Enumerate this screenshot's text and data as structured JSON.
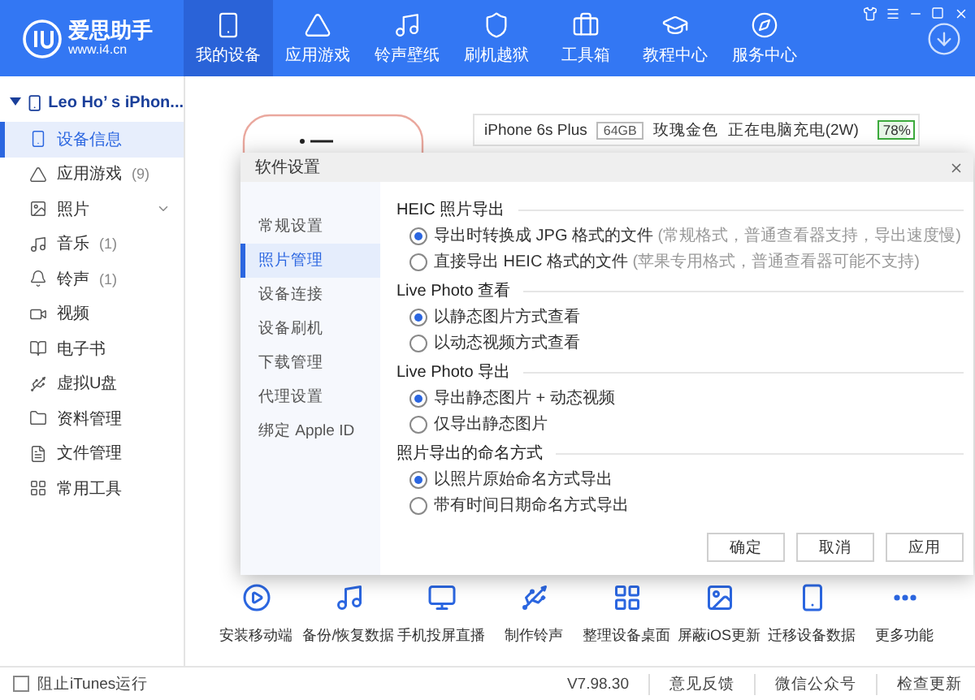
{
  "header": {
    "app_name": "爱思助手",
    "site": "www.i4.cn",
    "nav": [
      {
        "label": "我的设备",
        "selected": true
      },
      {
        "label": "应用游戏",
        "selected": false
      },
      {
        "label": "铃声壁纸",
        "selected": false
      },
      {
        "label": "刷机越狱",
        "selected": false
      },
      {
        "label": "工具箱",
        "selected": false
      },
      {
        "label": "教程中心",
        "selected": false
      },
      {
        "label": "服务中心",
        "selected": false
      }
    ]
  },
  "sidebar": {
    "device": "Leo Ho’ s iPhon...",
    "expanded": true,
    "items": [
      {
        "label": "设备信息",
        "selected": true
      },
      {
        "label": "应用游戏",
        "count": "(9)",
        "selected": false
      },
      {
        "label": "照片",
        "selected": false,
        "expandable": true
      },
      {
        "label": "音乐",
        "count": "(1)",
        "selected": false
      },
      {
        "label": "铃声",
        "count": "(1)",
        "selected": false
      },
      {
        "label": "视频",
        "selected": false
      },
      {
        "label": "电子书",
        "selected": false
      },
      {
        "label": "虚拟U盘",
        "selected": false
      },
      {
        "label": "资料管理",
        "selected": false
      },
      {
        "label": "文件管理",
        "selected": false
      },
      {
        "label": "常用工具",
        "selected": false
      }
    ]
  },
  "device_info": {
    "model": "iPhone 6s Plus",
    "capacity": "64GB",
    "finish": "玫瑰金色",
    "charging": "正在电脑充电(2W)",
    "battery": "78%",
    "level": 0.78
  },
  "toolbar": [
    "安装移动端",
    "备份/恢复数据",
    "手机投屏直播",
    "制作铃声",
    "整理设备桌面",
    "屏蔽iOS更新",
    "迁移设备数据",
    "更多功能"
  ],
  "dialog": {
    "title": "软件设置",
    "nav": [
      {
        "label": "常规设置",
        "selected": false
      },
      {
        "label": "照片管理",
        "selected": true
      },
      {
        "label": "设备连接",
        "selected": false
      },
      {
        "label": "设备刷机",
        "selected": false
      },
      {
        "label": "下载管理",
        "selected": false
      },
      {
        "label": "代理设置",
        "selected": false
      },
      {
        "label": "绑定 Apple ID",
        "selected": false
      }
    ],
    "sections": [
      {
        "title": "HEIC 照片导出",
        "options": [
          {
            "label": "导出时转换成 JPG 格式的文件",
            "hint": "(常规格式，普通查看器支持，导出速度慢)",
            "selected": true
          },
          {
            "label": "直接导出 HEIC 格式的文件",
            "hint": "(苹果专用格式，普通查看器可能不支持)",
            "selected": false
          }
        ]
      },
      {
        "title": "Live Photo 查看",
        "options": [
          {
            "label": "以静态图片方式查看",
            "selected": true
          },
          {
            "label": "以动态视频方式查看",
            "selected": false
          }
        ]
      },
      {
        "title": "Live Photo 导出",
        "options": [
          {
            "label": "导出静态图片 + 动态视频",
            "selected": true
          },
          {
            "label": "仅导出静态图片",
            "selected": false
          }
        ]
      },
      {
        "title": "照片导出的命名方式",
        "options": [
          {
            "label": "以照片原始命名方式导出",
            "selected": true
          },
          {
            "label": "带有时间日期命名方式导出",
            "selected": false
          }
        ]
      }
    ],
    "buttons": [
      "确定",
      "取消",
      "应用"
    ]
  },
  "status_bar": {
    "block_itunes": {
      "label": "阻止iTunes运行",
      "checked": false
    },
    "version": "V7.98.30",
    "links": [
      "意见反馈",
      "微信公众号",
      "检查更新"
    ]
  }
}
